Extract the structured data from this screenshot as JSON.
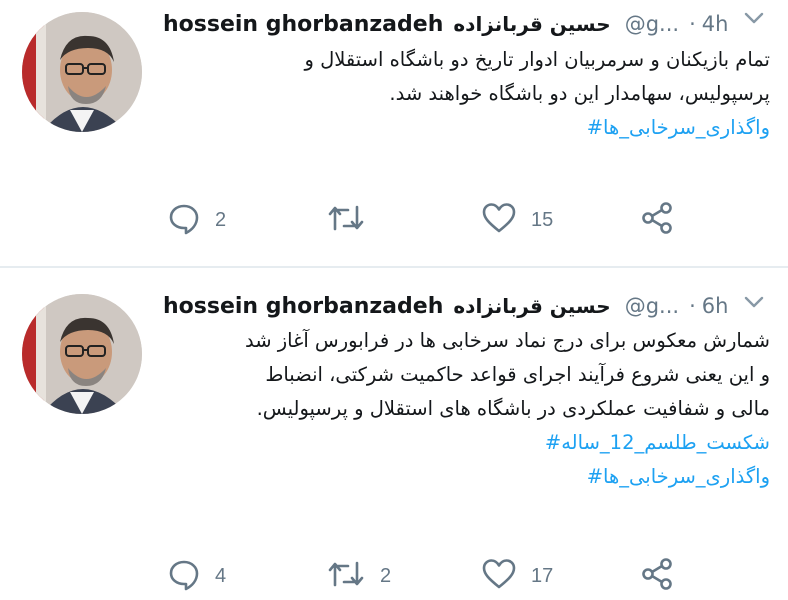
{
  "tweets": [
    {
      "author_name": "hossein ghorbanzadeh",
      "author_name_fa": "حسین قربانزاده",
      "handle": "@g...",
      "separator": "·",
      "time": "4h",
      "text_lines": [
        "تمام بازیکنان و سرمربیان ادوار تاریخ دو باشگاه استقلال و",
        "پرسپولیس، سهامدار این دو باشگاه خواهند شد."
      ],
      "hashtags": [
        "واگذاری_سرخابی_ها#"
      ],
      "reply_count": "2",
      "retweet_count": "",
      "like_count": "15"
    },
    {
      "author_name": "hossein ghorbanzadeh",
      "author_name_fa": "حسین قربانزاده",
      "handle": "@g...",
      "separator": "·",
      "time": "6h",
      "text_lines": [
        "شمارش معکوس برای درج نماد سرخابی ها در فرابورس آغاز شد",
        "و این یعنی شروع فرآیند اجرای قواعد حاکمیت شرکتی، انضباط",
        "مالی و شفافیت عملکردی در باشگاه های استقلال و پرسپولیس."
      ],
      "hashtags": [
        "شکست_طلسم_12_ساله#",
        "واگذاری_سرخابی_ها#"
      ],
      "reply_count": "4",
      "retweet_count": "2",
      "like_count": "17"
    }
  ],
  "colors": {
    "text": "#14171a",
    "secondary": "#657786",
    "link": "#1da1f2",
    "divider": "#e6ecf0"
  },
  "icons": {
    "reply": "reply-icon",
    "retweet": "retweet-icon",
    "like": "heart-icon",
    "share": "share-icon",
    "menu": "chevron-down-icon"
  }
}
